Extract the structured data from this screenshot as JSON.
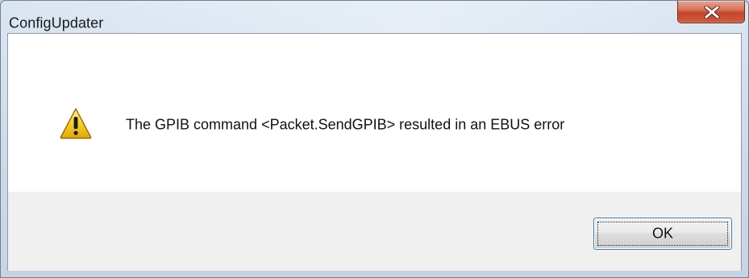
{
  "window": {
    "title": "ConfigUpdater",
    "close_icon": "close-icon"
  },
  "dialog": {
    "icon": "warning-icon",
    "message": "The GPIB command <Packet.SendGPIB> resulted in an EBUS error",
    "ok_label": "OK"
  },
  "colors": {
    "close_button": "#c6462c",
    "warning_yellow": "#f5c518",
    "focus_border": "#3c7fb1"
  }
}
